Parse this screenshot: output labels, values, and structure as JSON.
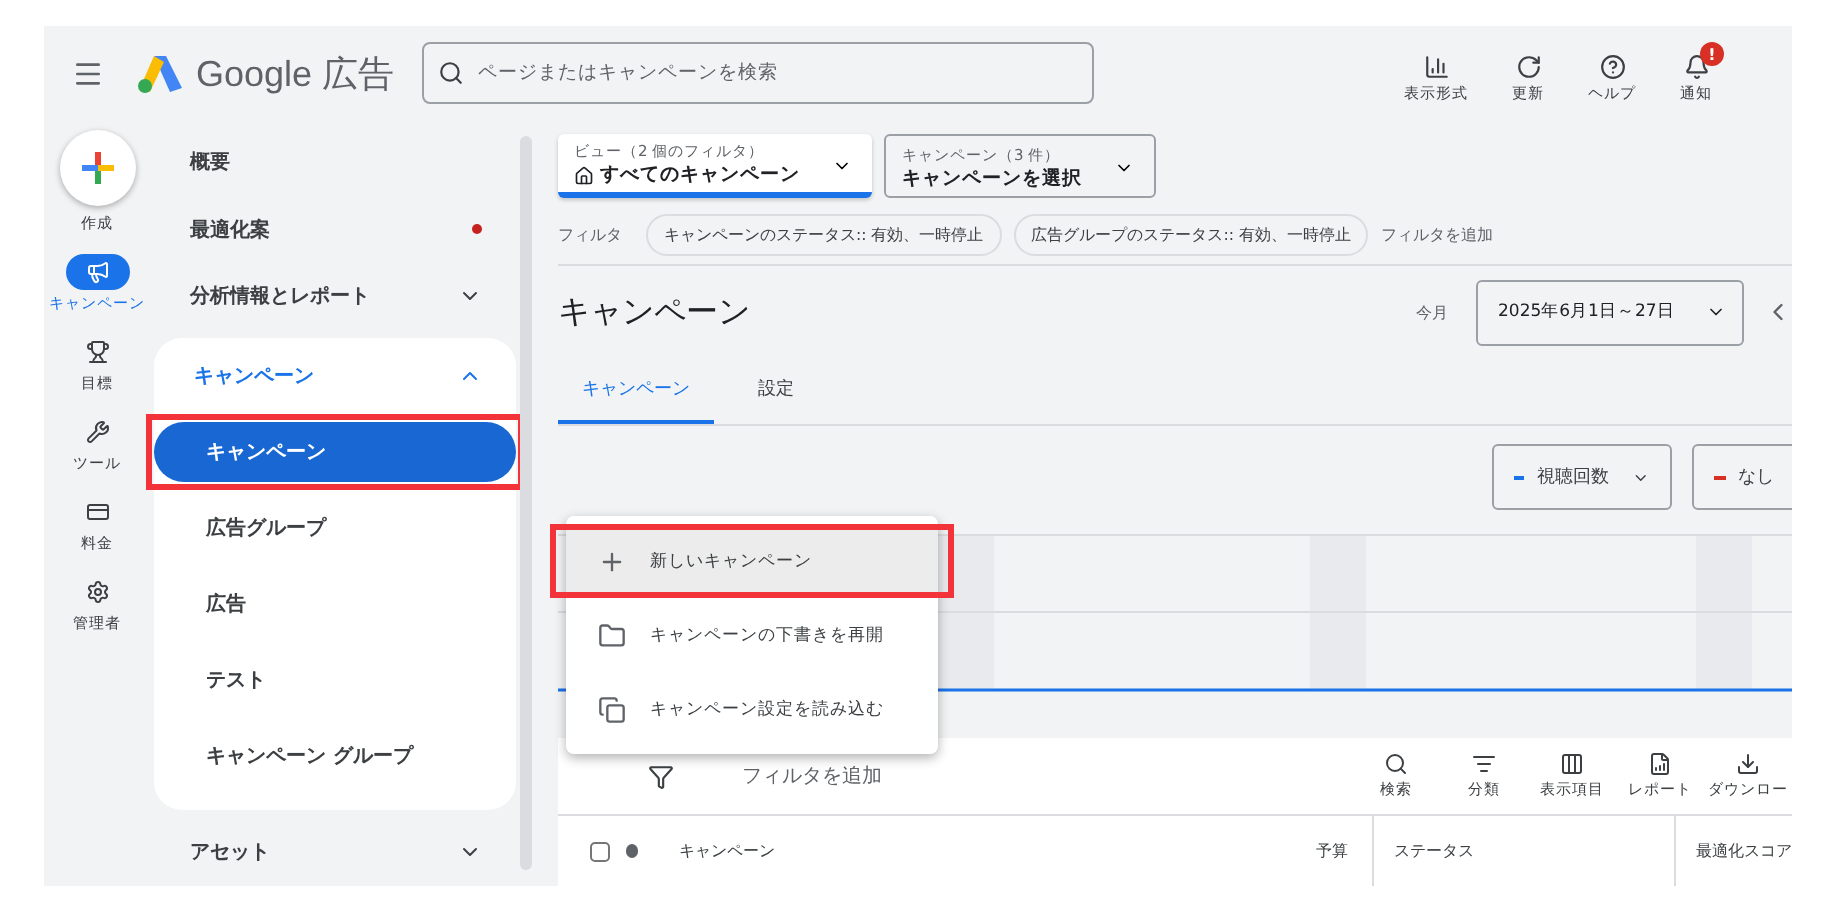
{
  "topbar": {
    "brand": "Google 広告",
    "search": {
      "placeholder": "ページまたはキャンペーンを検索"
    },
    "actions": [
      {
        "label": "表示形式"
      },
      {
        "label": "更新"
      },
      {
        "label": "ヘルプ"
      },
      {
        "label": "通知",
        "badge": "!"
      }
    ]
  },
  "rail": [
    {
      "label": "作成",
      "selected": false
    },
    {
      "label": "キャンペーン",
      "selected": true
    },
    {
      "label": "目標",
      "selected": false
    },
    {
      "label": "ツール",
      "selected": false
    },
    {
      "label": "料金",
      "selected": false
    },
    {
      "label": "管理者",
      "selected": false
    }
  ],
  "nav": [
    {
      "label": "概要",
      "kind": "link"
    },
    {
      "label": "最適化案",
      "kind": "alert"
    },
    {
      "label": "分析情報とレポート",
      "kind": "group",
      "expanded": false
    },
    {
      "label": "キャンペーン",
      "kind": "group",
      "expanded": true,
      "children": [
        {
          "label": "キャンペーン",
          "selected": true,
          "highlighted": true
        },
        {
          "label": "広告グループ",
          "selected": false,
          "highlighted": false
        },
        {
          "label": "広告",
          "selected": false,
          "highlighted": false
        },
        {
          "label": "テスト",
          "selected": false,
          "highlighted": false
        },
        {
          "label": "キャンペーン グループ",
          "selected": false,
          "highlighted": false
        }
      ]
    },
    {
      "label": "アセット",
      "kind": "group",
      "expanded": false
    }
  ],
  "selectors": [
    {
      "label": "ビュー（2 個のフィルタ）",
      "value": "すべてのキャンペーン",
      "kind": "view"
    },
    {
      "label": "キャンペーン（3 件）",
      "value": "キャンペーンを選択",
      "kind": "plain"
    }
  ],
  "filters": {
    "label": "フィルタ",
    "chips": [
      "キャンペーンのステータス:: 有効、一時停止",
      "広告グループのステータス:: 有効、一時停止"
    ],
    "add": "フィルタを追加"
  },
  "page_title": "キャンペーン",
  "date": {
    "label": "今月",
    "value": "2025年6月1日～27日"
  },
  "tabs": [
    {
      "label": "キャンペーン",
      "selected": true
    },
    {
      "label": "設定",
      "selected": false
    }
  ],
  "metrics": [
    {
      "label": "視聴回数",
      "color": "#1a73e8"
    },
    {
      "label": "なし",
      "color": "#d93025"
    }
  ],
  "menu": [
    {
      "label": "新しいキャンペーン",
      "highlighted": true
    },
    {
      "label": "キャンペーンの下書きを再開",
      "highlighted": false
    },
    {
      "label": "キャンペーン設定を読み込む",
      "highlighted": false
    }
  ],
  "table": {
    "select_all_checked": false,
    "add_filter": "フィルタを追加",
    "tools": [
      "検索",
      "分類",
      "表示項目",
      "レポート",
      "ダウンロー"
    ],
    "columns": [
      "キャンペーン",
      "予算",
      "ステータス",
      "最適化スコア"
    ]
  }
}
